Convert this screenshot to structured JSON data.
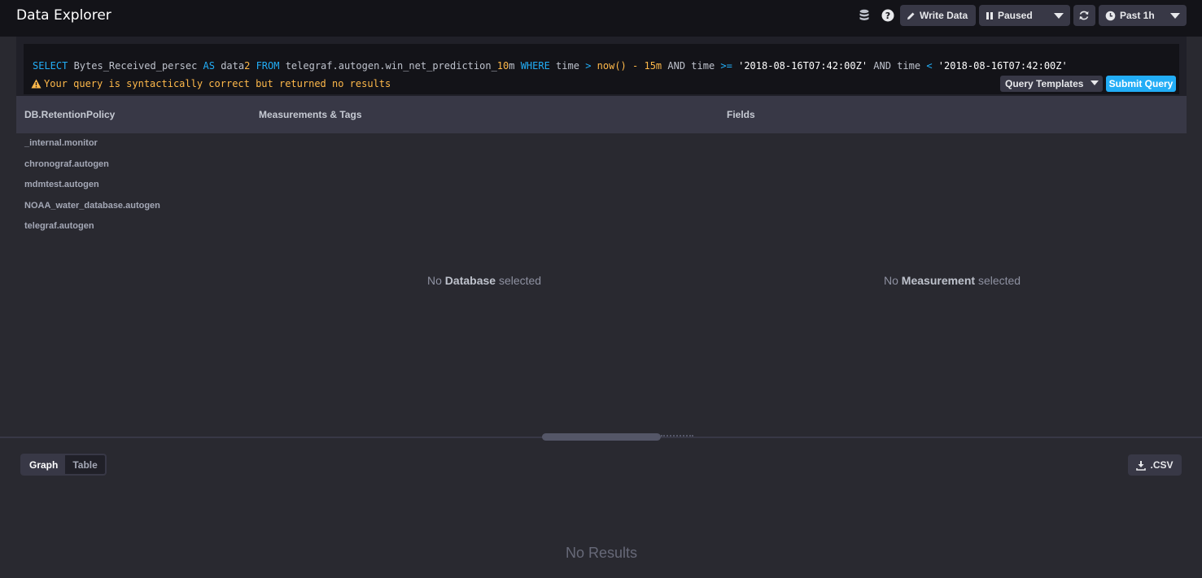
{
  "header": {
    "title": "Data Explorer",
    "write_data_label": "Write Data",
    "pause_label": "Paused",
    "time_range_label": "Past 1h"
  },
  "query": {
    "tokens": [
      {
        "t": "SELECT",
        "c": "kw"
      },
      {
        "t": " Bytes_Received_persec ",
        "c": ""
      },
      {
        "t": "AS",
        "c": "kw"
      },
      {
        "t": " data",
        "c": ""
      },
      {
        "t": "2",
        "c": "num"
      },
      {
        "t": " ",
        "c": ""
      },
      {
        "t": "FROM",
        "c": "kw"
      },
      {
        "t": " telegraf.autogen.win_net_prediction_",
        "c": ""
      },
      {
        "t": "10",
        "c": "num"
      },
      {
        "t": "m ",
        "c": ""
      },
      {
        "t": "WHERE",
        "c": "kw"
      },
      {
        "t": " time ",
        "c": ""
      },
      {
        "t": ">",
        "c": "op"
      },
      {
        "t": " ",
        "c": ""
      },
      {
        "t": "now()",
        "c": "fn"
      },
      {
        "t": " ",
        "c": ""
      },
      {
        "t": "-",
        "c": "fn"
      },
      {
        "t": " ",
        "c": ""
      },
      {
        "t": "15m",
        "c": "num"
      },
      {
        "t": " AND time ",
        "c": ""
      },
      {
        "t": ">=",
        "c": "op"
      },
      {
        "t": " ",
        "c": ""
      },
      {
        "t": "'2018-08-16T07:42:00Z'",
        "c": "str"
      },
      {
        "t": " AND time ",
        "c": ""
      },
      {
        "t": "<",
        "c": "op"
      },
      {
        "t": " ",
        "c": ""
      },
      {
        "t": "'2018-08-16T07:42:00Z'",
        "c": "str"
      }
    ],
    "status": "Your query is syntactically correct but returned no results",
    "templates_label": "Query Templates",
    "submit_label": "Submit Query"
  },
  "schema": {
    "col_db": "DB.RetentionPolicy",
    "col_measurements": "Measurements & Tags",
    "col_fields": "Fields",
    "databases": [
      "_internal.monitor",
      "chronograf.autogen",
      "mdmtest.autogen",
      "NOAA_water_database.autogen",
      "telegraf.autogen"
    ],
    "no_db_prefix": "No",
    "no_db_bold": "Database",
    "no_db_suffix": "selected",
    "no_meas_prefix": "No",
    "no_meas_bold": "Measurement",
    "no_meas_suffix": "selected"
  },
  "results": {
    "tab_graph": "Graph",
    "tab_table": "Table",
    "csv_label": ".CSV",
    "empty": "No Results"
  }
}
